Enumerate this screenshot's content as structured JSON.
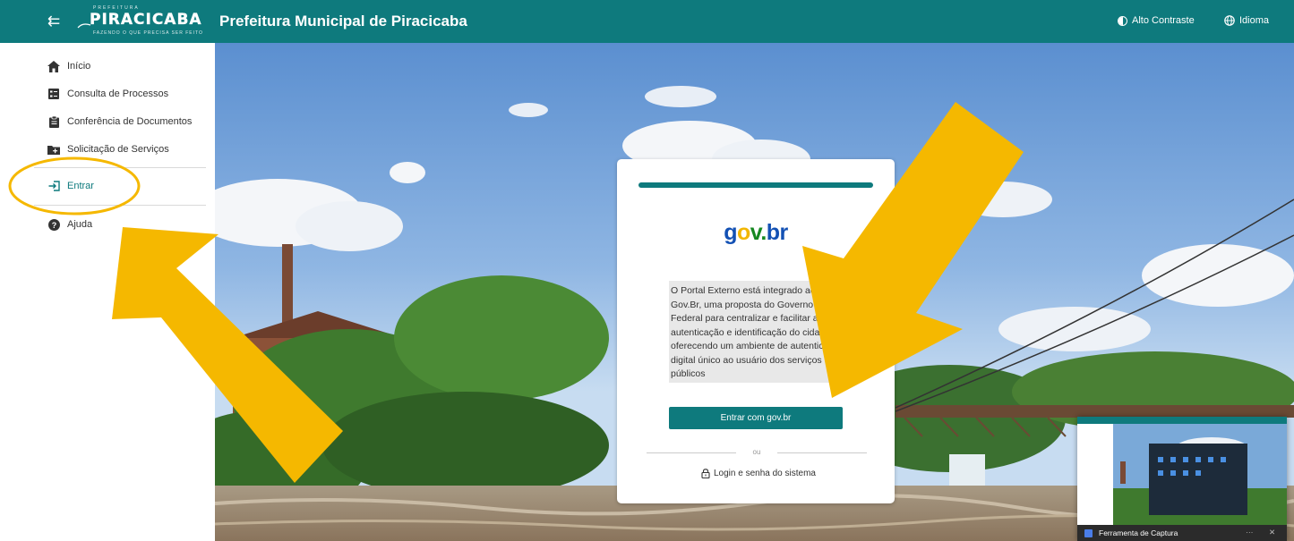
{
  "topbar": {
    "menu_icon": "menu-collapse-icon",
    "logo": {
      "small_text": "PREFEITURA",
      "big_text": "PIRACICABA",
      "slogan": "FAZENDO O QUE PRECISA SER FEITO"
    },
    "title": "Prefeitura Municipal de Piracicaba",
    "actions": [
      {
        "label": "Alto Contraste",
        "icon": "contrast-icon"
      },
      {
        "label": "Idioma",
        "icon": "globe-icon"
      }
    ],
    "color": "#0e7a7d"
  },
  "sidebar": {
    "items": [
      {
        "label": "Início",
        "icon": "home-icon"
      },
      {
        "label": "Consulta de Processos",
        "icon": "list-icon"
      },
      {
        "label": "Conferência de Documentos",
        "icon": "clipboard-icon"
      },
      {
        "label": "Solicitação de Serviços",
        "icon": "folder-plus-icon"
      },
      {
        "label": "Entrar",
        "icon": "login-icon"
      },
      {
        "label": "Ajuda",
        "icon": "help-icon"
      }
    ]
  },
  "card": {
    "logo_text": {
      "g": "g",
      "o": "o",
      "v": "v",
      "dot": ".",
      "br": "br"
    },
    "description_lines": [
      "O Portal Externo está integrado ao",
      "Gov.Br, uma proposta do Governo",
      "Federal para centralizar e facilitar a",
      "autenticação e identificação do cida",
      "oferecendo um ambiente de autentic",
      "digital único ao usuário dos serviços",
      "públicos"
    ],
    "govbr_button": "Entrar com gov.br",
    "separator": "ou",
    "system_login": "Login e senha do sistema"
  },
  "capture_widget": {
    "title": "Ferramenta de Captura",
    "more": "···",
    "close": "✕"
  },
  "annotation_color": "#f5b800"
}
